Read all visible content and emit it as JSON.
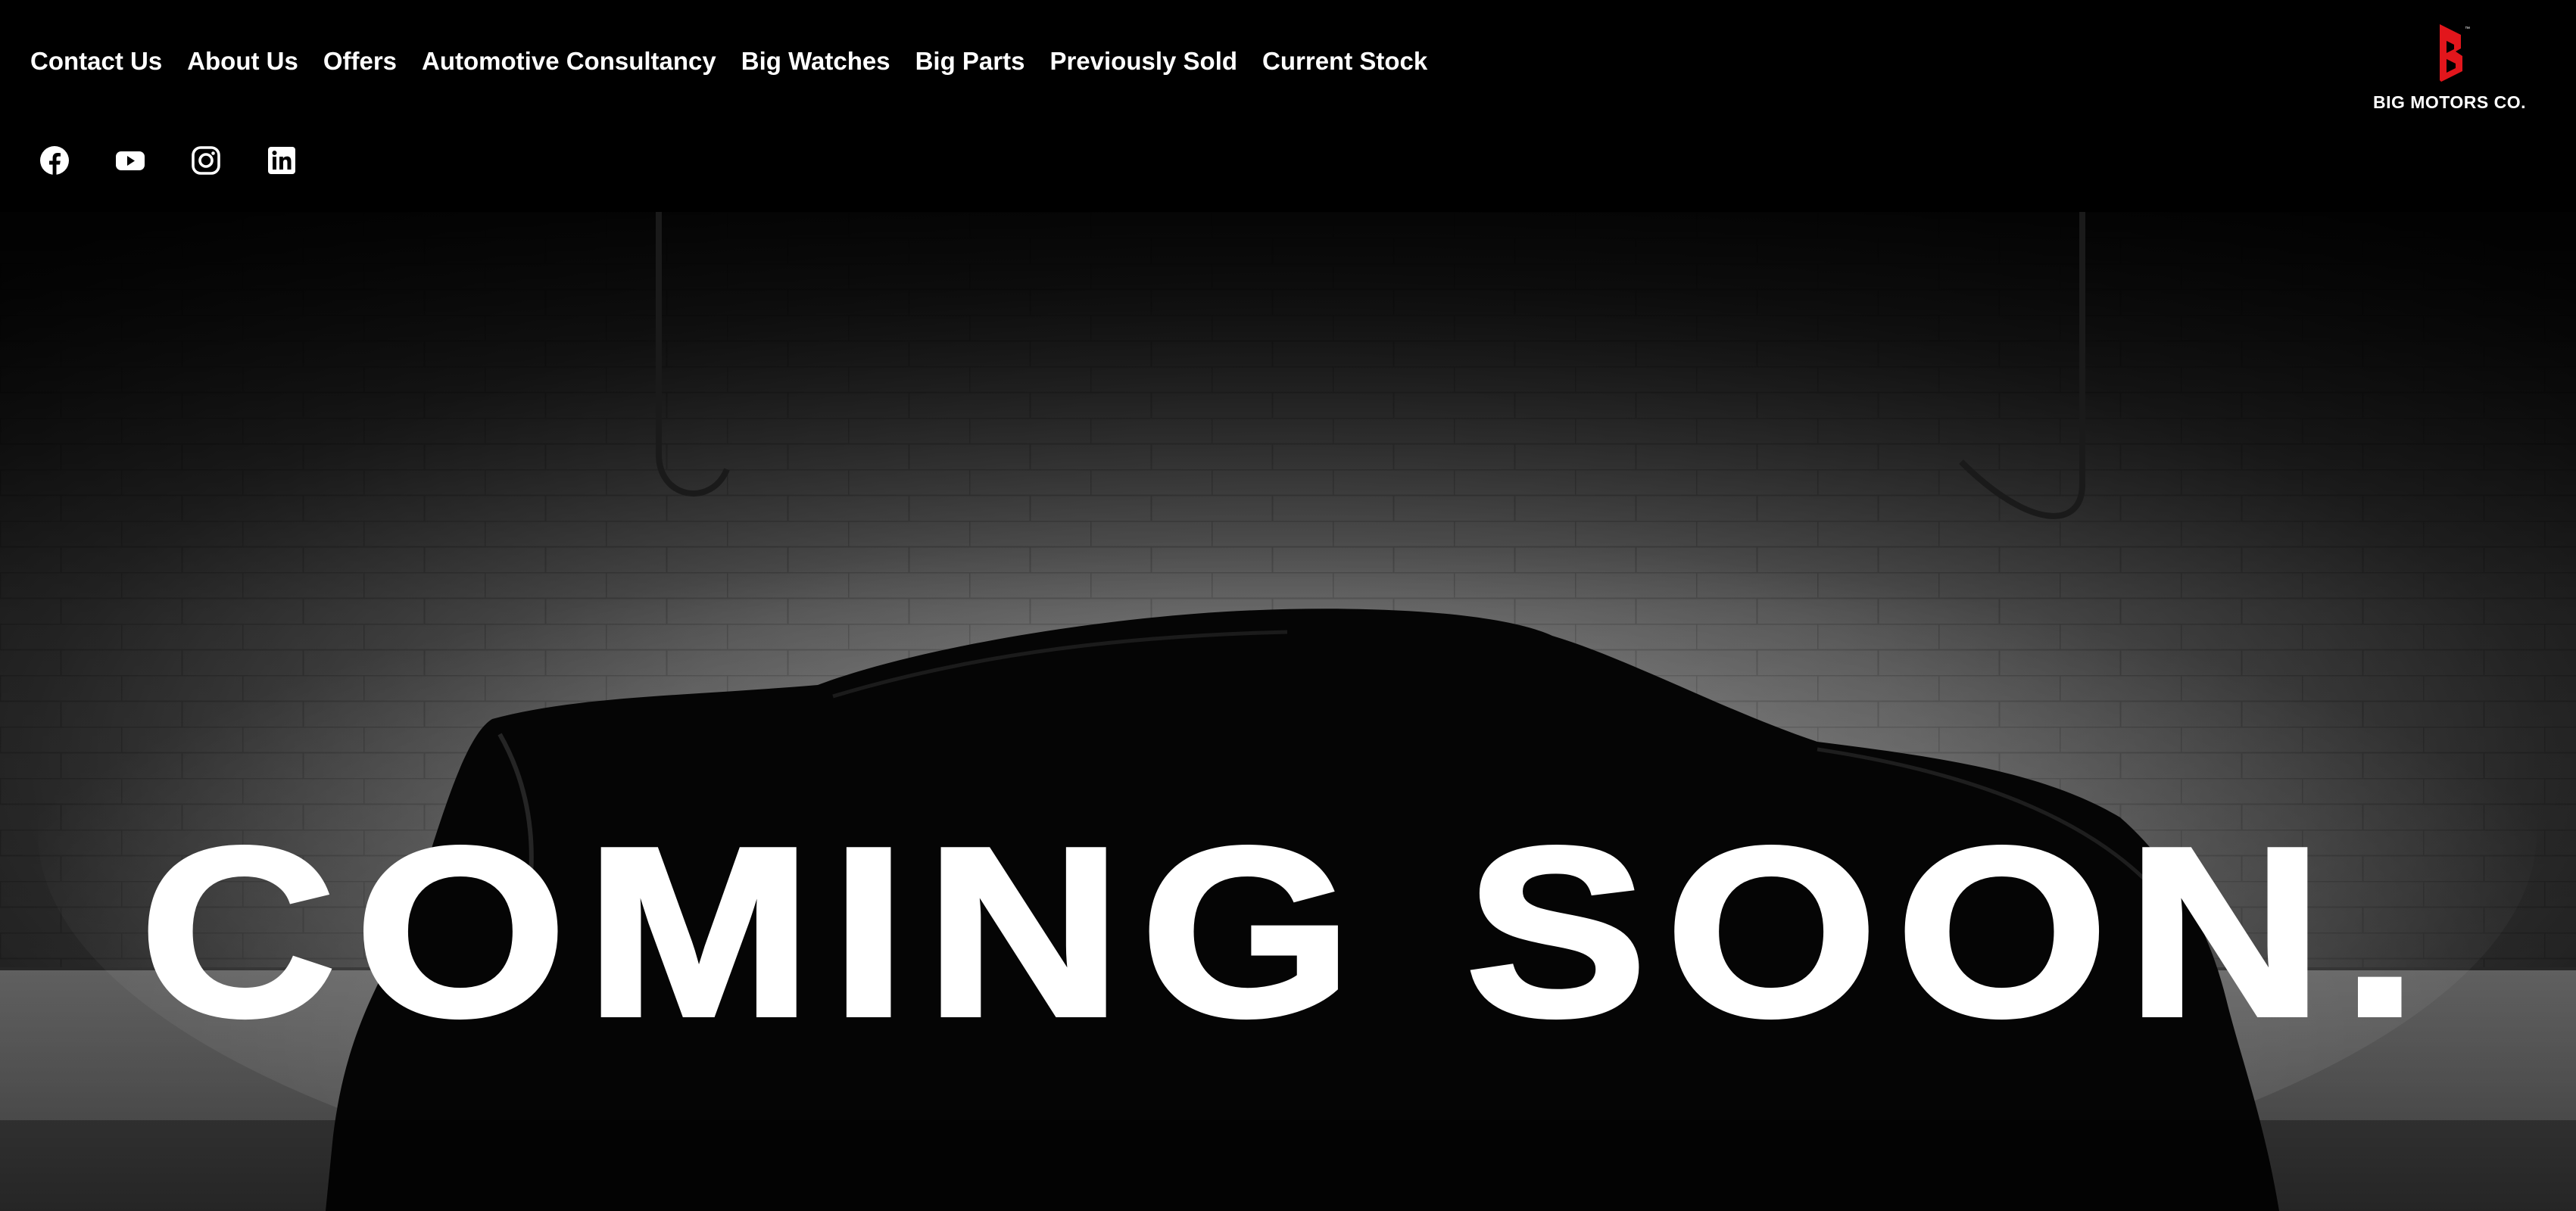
{
  "header": {
    "nav": [
      {
        "label": "Contact Us"
      },
      {
        "label": "About Us"
      },
      {
        "label": "Offers"
      },
      {
        "label": "Automotive Consultancy"
      },
      {
        "label": "Big Watches"
      },
      {
        "label": "Big Parts"
      },
      {
        "label": "Previously Sold"
      },
      {
        "label": "Current Stock"
      }
    ],
    "social": [
      {
        "icon": "facebook-icon"
      },
      {
        "icon": "youtube-icon"
      },
      {
        "icon": "instagram-icon"
      },
      {
        "icon": "linkedin-icon"
      }
    ],
    "brand": {
      "name": "BIG MOTORS CO.",
      "mark_color": "#e2161c",
      "icon": "big-motors-logo-icon"
    }
  },
  "hero": {
    "title": "COMING SOON.",
    "image": "covered-car-in-garage"
  },
  "colors": {
    "background": "#000000",
    "text": "#ffffff",
    "accent": "#e2161c"
  }
}
